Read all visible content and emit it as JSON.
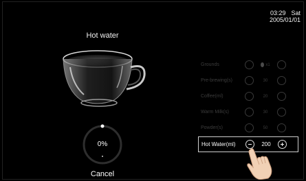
{
  "clock": {
    "time": "03:29",
    "day": "Sat",
    "date": "2005/01/01"
  },
  "drink": {
    "title": "Hot water"
  },
  "progress": {
    "percent_text": "0%",
    "value": 0
  },
  "actions": {
    "cancel_label": "Cancel"
  },
  "settings": [
    {
      "label": "Grounds",
      "value": "x1",
      "icon": "bean-icon"
    },
    {
      "label": "Pre-brewing(s)",
      "value": "30"
    },
    {
      "label": "Coffee(ml)",
      "value": "20"
    },
    {
      "label": "Warm Milk(s)",
      "value": "30"
    },
    {
      "label": "Powder(s)",
      "value": "50"
    },
    {
      "label": "Hot Water(ml)",
      "value": "200",
      "active": true
    }
  ]
}
